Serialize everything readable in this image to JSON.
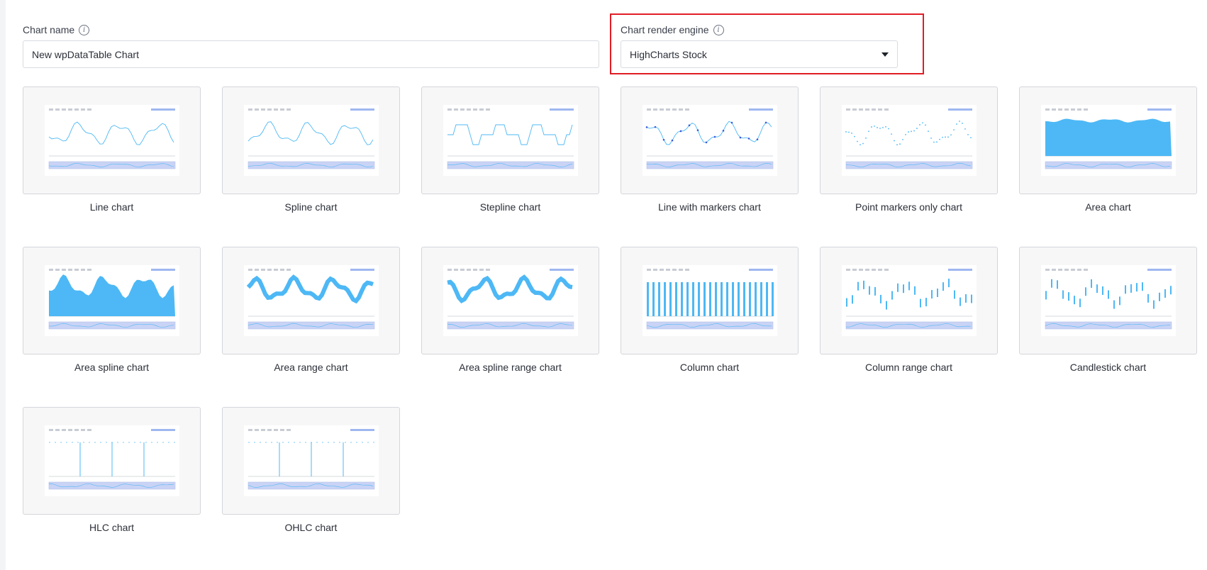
{
  "form": {
    "chart_name_label": "Chart name",
    "chart_name_value": "New wpDataTable Chart",
    "engine_label": "Chart render engine",
    "engine_value": "HighCharts Stock"
  },
  "chart_types": [
    {
      "label": "Line chart",
      "icon": "line-chart-thumbnail"
    },
    {
      "label": "Spline chart",
      "icon": "spline-chart-thumbnail"
    },
    {
      "label": "Stepline chart",
      "icon": "stepline-chart-thumbnail"
    },
    {
      "label": "Line with markers chart",
      "icon": "line-markers-chart-thumbnail"
    },
    {
      "label": "Point markers only chart",
      "icon": "point-markers-chart-thumbnail"
    },
    {
      "label": "Area chart",
      "icon": "area-chart-thumbnail"
    },
    {
      "label": "Area spline chart",
      "icon": "area-spline-chart-thumbnail"
    },
    {
      "label": "Area range chart",
      "icon": "area-range-chart-thumbnail"
    },
    {
      "label": "Area spline range chart",
      "icon": "area-spline-range-chart-thumbnail"
    },
    {
      "label": "Column chart",
      "icon": "column-chart-thumbnail"
    },
    {
      "label": "Column range chart",
      "icon": "column-range-chart-thumbnail"
    },
    {
      "label": "Candlestick chart",
      "icon": "candlestick-chart-thumbnail"
    },
    {
      "label": "HLC chart",
      "icon": "hlc-chart-thumbnail"
    },
    {
      "label": "OHLC chart",
      "icon": "ohlc-chart-thumbnail"
    }
  ],
  "colors": {
    "accent": "#4db8f5",
    "highlight": "#e11d24",
    "navigator": "#c9d3f5"
  }
}
